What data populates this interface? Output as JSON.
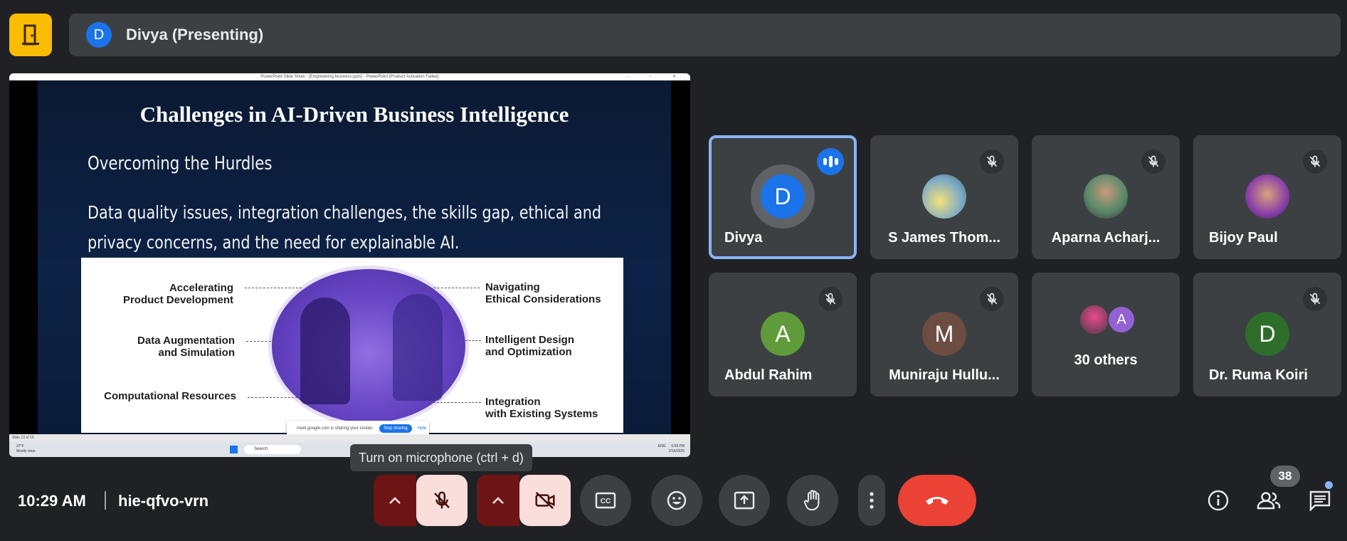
{
  "presenter": {
    "initial": "D",
    "label": "Divya (Presenting)"
  },
  "share": {
    "window_title": "PowerPoint Slide Show - [Empowering business.pptx] - PowerPoint (Product Activation Failed)",
    "notice_text": "meet.google.com is sharing your screen.",
    "stop_label": "Stop sharing",
    "hide_label": "Hide",
    "statusbar": "Slide 13 of 15",
    "weather_temp": "37°F",
    "weather_desc": "Mostly clear",
    "search": "Search",
    "lang": "ENG",
    "time": "6:59 PM",
    "date": "2/16/2025"
  },
  "slide": {
    "title": "Challenges in AI-Driven Business Intelligence",
    "subtitle": "Overcoming the Hurdles",
    "body": "Data quality issues, integration challenges, the skills gap, ethical and privacy concerns, and the need for explainable AI.",
    "labels": {
      "l1a": "Accelerating",
      "l1b": "Product Development",
      "l2a": "Data Augmentation",
      "l2b": "and Simulation",
      "l3a": "Computational Resources",
      "r1a": "Navigating",
      "r1b": "Ethical Considerations",
      "r2a": "Intelligent Design",
      "r2b": "and Optimization",
      "r3a": "Integration",
      "r3b": "with Existing Systems"
    }
  },
  "participants": [
    {
      "name": "Divya",
      "initial": "D",
      "color": "#1a73e8"
    },
    {
      "name": "S James Thom...",
      "color": "#6b8f5a"
    },
    {
      "name": "Aparna Acharj...",
      "color": "#7a5b4a"
    },
    {
      "name": "Bijoy Paul",
      "color": "#8a4fa8"
    },
    {
      "name": "Abdul Rahim",
      "initial": "A",
      "color": "#5f9b3a"
    },
    {
      "name": "Muniraju Hullu...",
      "initial": "M",
      "color": "#6d4c41"
    },
    {
      "name": "30 others",
      "initial2": "A"
    },
    {
      "name": "Dr. Ruma Koiri",
      "initial": "D",
      "color": "#2e6e2a"
    }
  ],
  "tooltip": "Turn on microphone (ctrl + d)",
  "bottom": {
    "time": "10:29 AM",
    "meeting_code": "hie-qfvo-vrn",
    "people_count": "38"
  },
  "colors": {
    "accent": "#8ab4f8",
    "end_call": "#ea4335",
    "door": "#fbbc04"
  }
}
